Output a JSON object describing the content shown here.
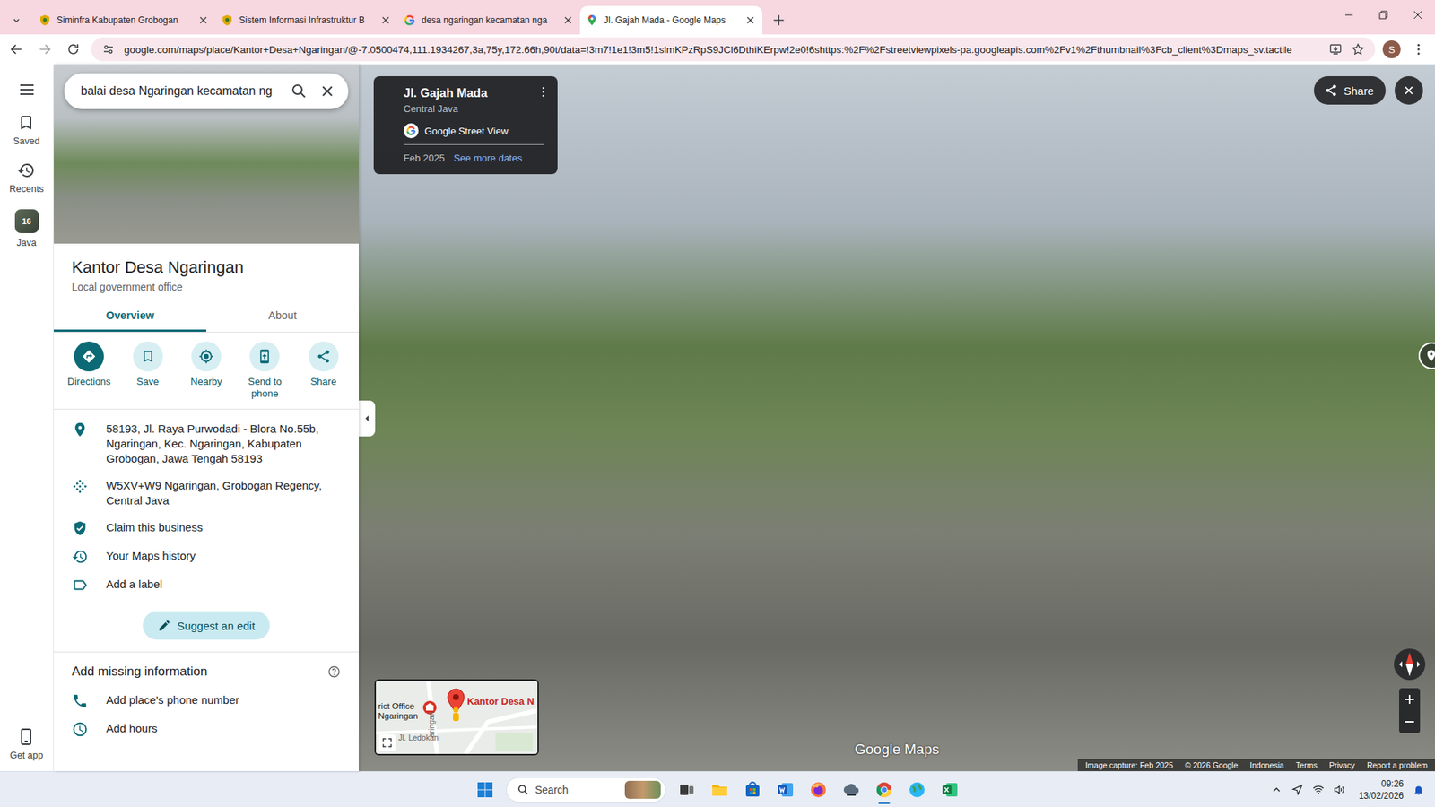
{
  "browser": {
    "tabs": [
      {
        "label": "Siminfra Kabupaten Grobogan",
        "selected": false
      },
      {
        "label": "Sistem Informasi Infrastruktur B",
        "selected": false
      },
      {
        "label": "desa ngaringan kecamatan nga",
        "selected": false
      },
      {
        "label": "Jl. Gajah Mada - Google Maps",
        "selected": true
      }
    ],
    "url": "google.com/maps/place/Kantor+Desa+Ngaringan/@-7.0500474,111.1934267,3a,75y,172.66h,90t/data=!3m7!1e1!3m5!1slmKPzRpS9JCl6DthiKErpw!2e0!6shttps:%2F%2Fstreetviewpixels-pa.googleapis.com%2Fv1%2Fthumbnail%3Fcb_client%3Dmaps_sv.tactile",
    "profile": "S"
  },
  "maps": {
    "search": {
      "value": "balai desa Ngaringan kecamatan ng"
    },
    "rail": [
      {
        "label": "Saved"
      },
      {
        "label": "Recents"
      },
      {
        "label": "Java",
        "badge": "16"
      }
    ],
    "get_app": "Get app",
    "place": {
      "title": "Kantor Desa Ngaringan",
      "category": "Local government office",
      "tabs": [
        {
          "label": "Overview",
          "selected": true
        },
        {
          "label": "About",
          "selected": false
        }
      ],
      "actions": [
        {
          "label": "Directions",
          "primary": true
        },
        {
          "label": "Save",
          "primary": false
        },
        {
          "label": "Nearby",
          "primary": false
        },
        {
          "label": "Send to phone",
          "primary": false
        },
        {
          "label": "Share",
          "primary": false
        }
      ],
      "details": [
        "58193, Jl. Raya Purwodadi - Blora No.55b, Ngaringan, Kec. Ngaringan, Kabupaten Grobogan, Jawa Tengah 58193",
        "W5XV+W9 Ngaringan, Grobogan Regency, Central Java",
        "Claim this business",
        "Your Maps history",
        "Add a label"
      ],
      "suggest_button": "Suggest an edit",
      "missing": {
        "title": "Add missing information",
        "items": [
          "Add place's phone number",
          "Add hours"
        ]
      }
    },
    "street_view": {
      "card": {
        "street": "Jl. Gajah Mada",
        "region": "Central Java",
        "source": "Google Street View",
        "date": "Feb 2025",
        "more_dates": "See more dates"
      },
      "share": "Share",
      "minimap": {
        "place": "Kantor Desa N",
        "office": [
          "rict Office",
          "Ngaringan"
        ],
        "road": "Jl. Ledokan",
        "road2": "aringan"
      },
      "watermark": "Google Maps",
      "footer": [
        "Image capture: Feb 2025",
        "© 2026 Google",
        "Indonesia",
        "Terms",
        "Privacy",
        "Report a problem"
      ]
    }
  },
  "taskbar": {
    "search": "Search",
    "apps": [
      {
        "active": false
      },
      {
        "active": false
      },
      {
        "active": false
      },
      {
        "active": false
      },
      {
        "active": false
      },
      {
        "active": false
      },
      {
        "active": true
      },
      {
        "active": false
      },
      {
        "active": false
      }
    ],
    "time": "09:26",
    "date": "13/02/2026"
  }
}
